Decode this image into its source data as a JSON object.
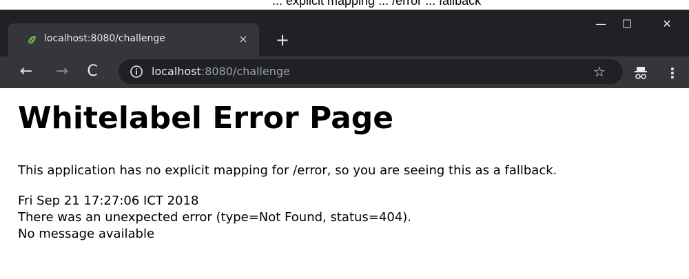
{
  "top_strip_text": "... explicit mapping ... /error ... fallback",
  "browser": {
    "tab": {
      "title": "localhost:8080/challenge",
      "close_glyph": "×",
      "favicon_icon": "spring-leaf-icon"
    },
    "new_tab_glyph": "+",
    "window_controls": {
      "minimize_glyph": "—",
      "maximize_glyph": "☐",
      "close_glyph": "✕"
    },
    "toolbar": {
      "back_glyph": "←",
      "forward_glyph": "→",
      "reload_glyph": "C",
      "url_host": "localhost",
      "url_rest": ":8080/challenge",
      "star_glyph": "☆",
      "menu_glyph": "⋮"
    },
    "colors": {
      "tabbar_bg": "#202124",
      "toolbar_bg": "#35363a",
      "omnibox_bg": "#202124",
      "text": "#e8eaed",
      "muted_text": "#9aa0a6",
      "favicon": "#6db33f"
    }
  },
  "page": {
    "heading": "Whitelabel Error Page",
    "lead": "This application has no explicit mapping for /error, so you are seeing this as a fallback.",
    "timestamp": "Fri Sep 21 17:27:06 ICT 2018",
    "error_line": "There was an unexpected error (type=Not Found, status=404).",
    "message": "No message available"
  }
}
